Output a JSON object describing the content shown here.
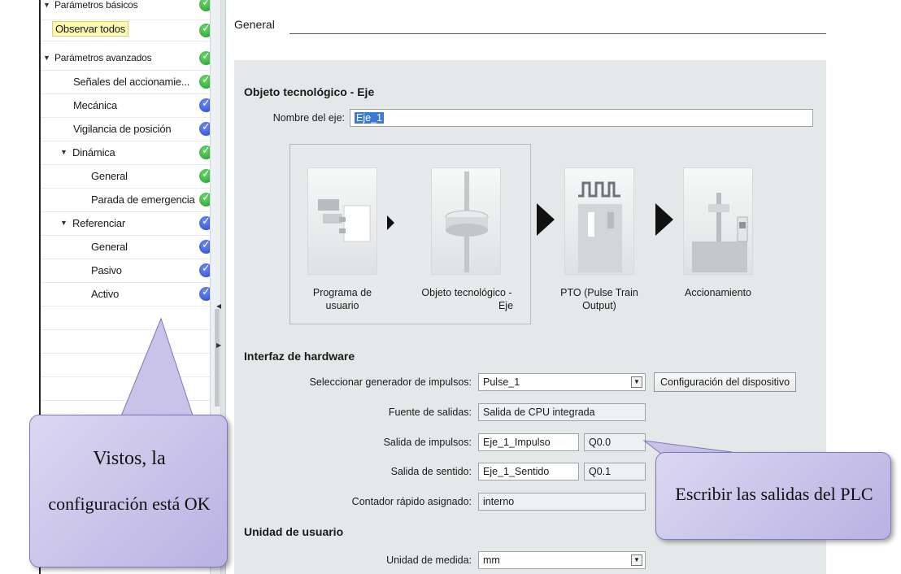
{
  "tree": {
    "items": [
      {
        "label": "Parámetros básicos",
        "expanded": true,
        "status": "ok"
      },
      {
        "label": "Observar todos",
        "highlighted": true,
        "status": "ok"
      },
      {
        "label": "Parámetros avanzados",
        "expanded": true,
        "status": "ok"
      },
      {
        "label": "Señales del accionamie...",
        "status": "ok"
      },
      {
        "label": "Mecánica",
        "status": "info"
      },
      {
        "label": "Vigilancia de posición",
        "status": "info"
      },
      {
        "label": "Dinámica",
        "expanded": true,
        "status": "ok"
      },
      {
        "label": "General",
        "status": "ok"
      },
      {
        "label": "Parada de emergencia",
        "status": "ok"
      },
      {
        "label": "Referenciar",
        "expanded": true,
        "status": "info"
      },
      {
        "label": "General",
        "status": "info"
      },
      {
        "label": "Pasivo",
        "status": "info"
      },
      {
        "label": "Activo",
        "status": "info"
      }
    ]
  },
  "header": {
    "title": "General"
  },
  "tech_object": {
    "section_title": "Objeto tecnológico - Eje",
    "axis_name_label": "Nombre del eje:",
    "axis_name_value": "Eje_1"
  },
  "flow": {
    "steps": [
      {
        "label": "Programa de usuario",
        "line1": "Programa de",
        "line2": "usuario"
      },
      {
        "label": "Objeto tecnológico - Eje",
        "line1": "Objeto tecnológico -",
        "line2": "Eje"
      },
      {
        "label": "PTO (Pulse Train Output)",
        "line1": "PTO (Pulse Train",
        "line2": "Output)"
      },
      {
        "label": "Accionamiento",
        "line1": "Accionamiento",
        "line2": ""
      }
    ]
  },
  "hardware": {
    "section_title": "Interfaz de hardware",
    "pulse_gen_label": "Seleccionar generador de impulsos:",
    "pulse_gen_value": "Pulse_1",
    "device_config_button": "Configuración del dispositivo",
    "output_source_label": "Fuente de salidas:",
    "output_source_value": "Salida de CPU integrada",
    "pulse_output_label": "Salida de impulsos:",
    "pulse_output_value": "Eje_1_Impulso",
    "pulse_output_address": "Q0.0",
    "direction_output_label": "Salida de sentido:",
    "direction_output_value": "Eje_1_Sentido",
    "direction_output_address": "Q0.1",
    "fast_counter_label": "Contador rápido asignado:",
    "fast_counter_value": "interno"
  },
  "user_unit": {
    "section_title": "Unidad de usuario",
    "unit_label": "Unidad de medida:",
    "unit_value": "mm"
  },
  "callouts": {
    "left_line1": "Vistos, la",
    "left_line2": "configuración está OK",
    "right": "Escribir las salidas del PLC"
  },
  "colors": {
    "ok": "#1e9a2a",
    "info": "#2443c9",
    "selection": "#3b78d8",
    "callout": "#c9c3ea"
  }
}
